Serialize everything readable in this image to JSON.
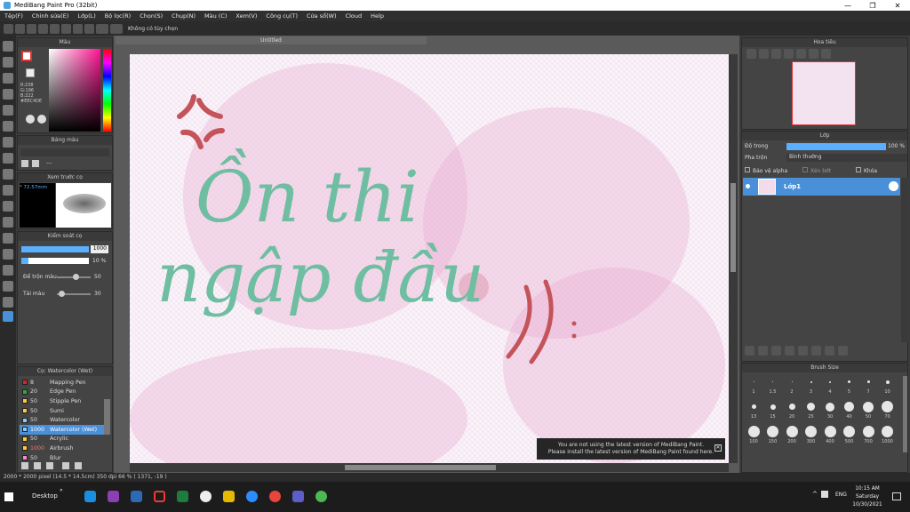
{
  "window": {
    "title": "MediBang Paint Pro (32bit)",
    "minimize": "—",
    "restore": "❐",
    "close": "✕"
  },
  "menu": [
    "Tệp(F)",
    "Chỉnh sửa(E)",
    "Lớp(L)",
    "Bộ lọc(R)",
    "Chọn(S)",
    "Chụp(N)",
    "Màu (C)",
    "Xem(V)",
    "Công cụ(T)",
    "Cửa sổ(W)",
    "Cloud",
    "Help"
  ],
  "toolbar": {
    "option_text": "Không có tùy chọn"
  },
  "canvas": {
    "tab": "Untitled",
    "text_line1": "Ồn thi",
    "text_line2": "ngập đầu",
    "ink_color": "#6fbea2",
    "accent_color": "#c4535a"
  },
  "color_panel": {
    "title": "Màu",
    "r": "R:238",
    "g": "G:196",
    "b": "B:222",
    "hex": "#EEC4DE",
    "fg": "#eec4de"
  },
  "palette_panel": {
    "title": "Bảng màu",
    "value": "---"
  },
  "preview_panel": {
    "title": "Xem trước cọ",
    "size": "* 72.57mm"
  },
  "brush_control": {
    "title": "Kiểm soát cọ",
    "size_value": "1000",
    "opacity_value": "10 %",
    "mix_label": "Để trộn màu",
    "mix_value": "50",
    "load_label": "Tải màu",
    "load_value": "30"
  },
  "brush_list": {
    "title": "Cọ: Watercolor (Wet)",
    "items": [
      {
        "num": "8",
        "name": "Mapping Pen",
        "color": "#d22"
      },
      {
        "num": "20",
        "name": "Edge Pen",
        "color": "#3a3"
      },
      {
        "num": "50",
        "name": "Stipple Pen",
        "color": "#fc3"
      },
      {
        "num": "50",
        "name": "Sumi",
        "color": "#fc3"
      },
      {
        "num": "50",
        "name": "Watercolor",
        "color": "#8cf"
      },
      {
        "num": "1000",
        "name": "Watercolor (Wet)",
        "color": "#8cf"
      },
      {
        "num": "50",
        "name": "Acrylic",
        "color": "#fc3"
      },
      {
        "num": "1000",
        "name": "Airbrush",
        "color": "#fc3"
      },
      {
        "num": "50",
        "name": "Blur",
        "color": "#f8c"
      }
    ]
  },
  "navigator": {
    "title": "Hoa tiêu"
  },
  "layer_panel": {
    "title": "Lớp",
    "opacity_label": "Độ trong",
    "opacity_value": "100 %",
    "blend_label": "Pha trộn",
    "blend_value": "Bình thường",
    "protect_alpha": "Bảo vệ alpha",
    "clipping": "Xén bớt",
    "lock": "Khóa",
    "layer_name": "Lớp1"
  },
  "brush_size": {
    "title": "Brush Size",
    "row1": [
      "1",
      "1.5",
      "2",
      "3",
      "4",
      "5",
      "7",
      "10"
    ],
    "row2": [
      "13",
      "15",
      "20",
      "25",
      "30",
      "40",
      "50",
      "70"
    ],
    "row3": [
      "100",
      "150",
      "200",
      "300",
      "400",
      "500",
      "700",
      "1000"
    ]
  },
  "notice": {
    "line1": "You are not using the latest version of MediBang Paint.",
    "line2": "Please install the latest version of MediBang Paint found here."
  },
  "status": {
    "text": "2000 * 2000 pixel  (14.5 * 14.5cm)  350 dpi  66 %  ( 1371, -19 )"
  },
  "taskbar": {
    "desktop": "Desktop",
    "lang": "ENG",
    "time": "10:15 AM",
    "day": "Saturday",
    "date": "10/30/2021"
  }
}
